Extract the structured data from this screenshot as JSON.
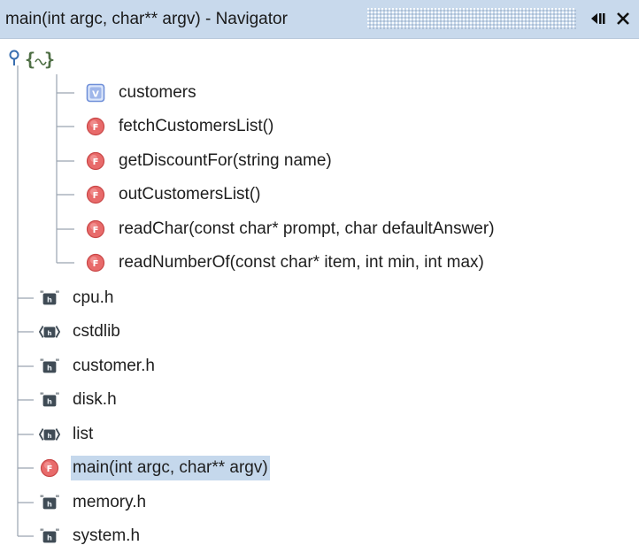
{
  "window": {
    "title": "main(int argc, char** argv) - Navigator"
  },
  "tree": {
    "root": {
      "icon": "namespace-braces-icon"
    },
    "members": [
      {
        "label": "customers",
        "icon": "variable-icon"
      },
      {
        "label": "fetchCustomersList()",
        "icon": "function-icon"
      },
      {
        "label": "getDiscountFor(string name)",
        "icon": "function-icon"
      },
      {
        "label": "outCustomersList()",
        "icon": "function-icon"
      },
      {
        "label": "readChar(const char* prompt, char defaultAnswer)",
        "icon": "function-icon"
      },
      {
        "label": "readNumberOf(const char* item, int min, int max)",
        "icon": "function-icon"
      }
    ],
    "items": [
      {
        "label": "cpu.h",
        "icon": "include-header-icon"
      },
      {
        "label": "cstdlib",
        "icon": "include-system-icon"
      },
      {
        "label": "customer.h",
        "icon": "include-header-icon"
      },
      {
        "label": "disk.h",
        "icon": "include-header-icon"
      },
      {
        "label": "list",
        "icon": "include-system-icon"
      },
      {
        "label": "main(int argc, char** argv)",
        "icon": "function-icon",
        "selected": true
      },
      {
        "label": "memory.h",
        "icon": "include-header-icon"
      },
      {
        "label": "system.h",
        "icon": "include-header-icon"
      }
    ]
  },
  "colors": {
    "titlebar": "#c8d9ec",
    "selection": "#c5d8ec",
    "function": "#e05a5a",
    "variable": "#6f8fd8",
    "tree_lines": "#9aa4b0"
  }
}
